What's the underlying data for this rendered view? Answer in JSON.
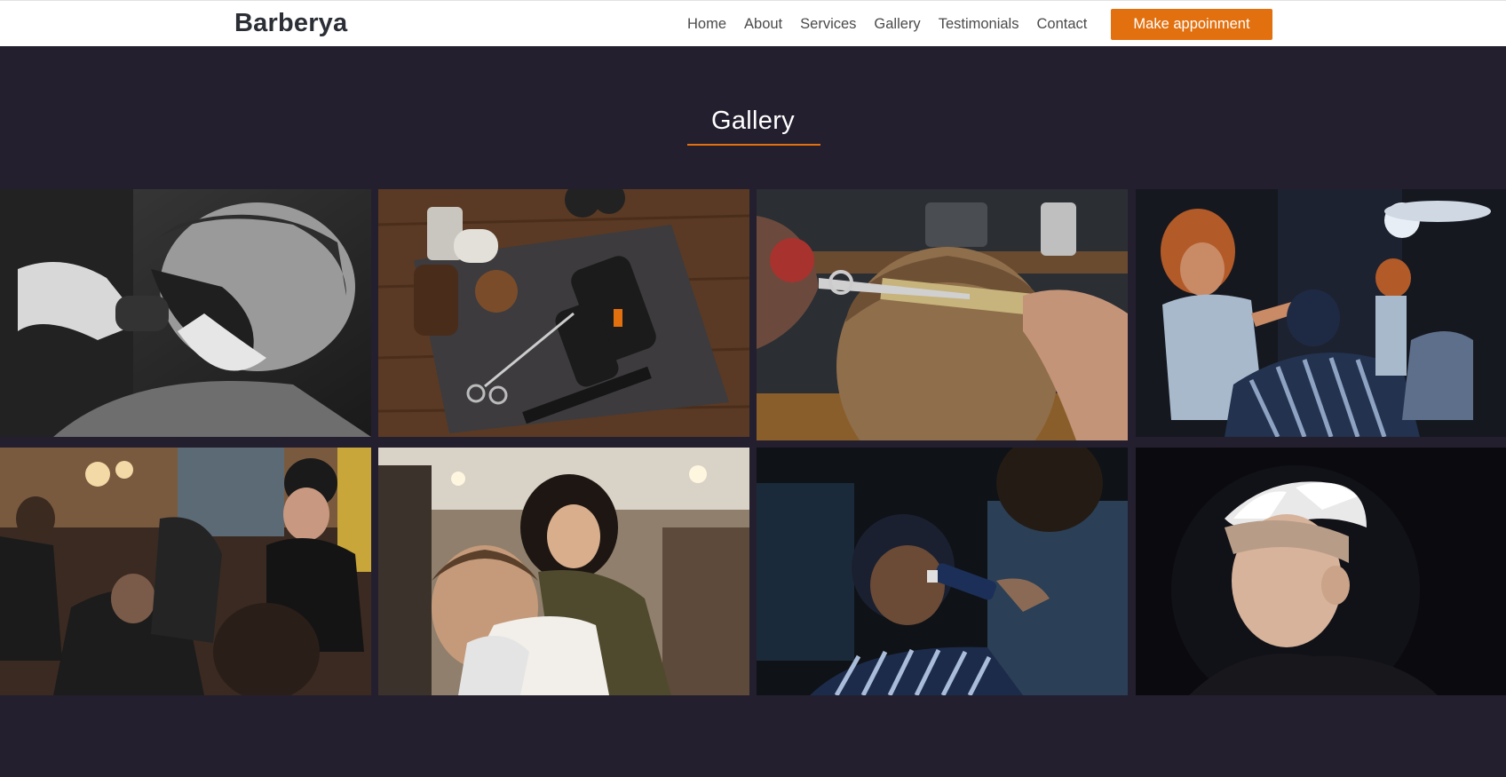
{
  "brand": "Barberya",
  "nav": {
    "links": [
      "Home",
      "About",
      "Services",
      "Gallery",
      "Testimonials",
      "Contact"
    ],
    "cta": "Make appoinment"
  },
  "gallery": {
    "title": "Gallery",
    "photos": [
      "beard-shaving-photo",
      "barber-tools-photo",
      "haircut-scissors-comb-photo",
      "barber-cutting-hair-photo",
      "barbershop-interior-photo",
      "woman-barber-photo",
      "hair-clipper-photo",
      "platinum-hairstyle-photo"
    ]
  },
  "colors": {
    "accent": "#e2700f",
    "background": "#241f2e",
    "navbar": "#ffffff"
  }
}
